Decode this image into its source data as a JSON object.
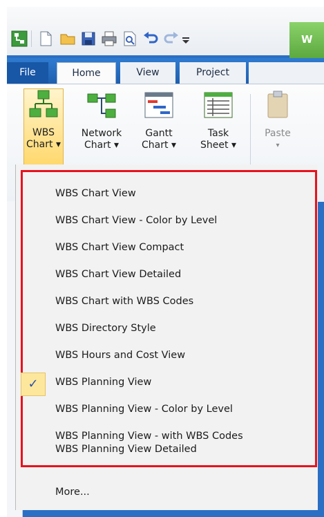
{
  "window": {
    "title_fragment": "W"
  },
  "tabs": [
    {
      "label": "File"
    },
    {
      "label": "Home"
    },
    {
      "label": "View"
    },
    {
      "label": "Project"
    }
  ],
  "ribbon": {
    "buttons": [
      {
        "line1": "WBS",
        "line2": "Chart ▾",
        "icon": "wbs-chart-icon"
      },
      {
        "line1": "Network",
        "line2": "Chart ▾",
        "icon": "network-chart-icon"
      },
      {
        "line1": "Gantt",
        "line2": "Chart ▾",
        "icon": "gantt-chart-icon"
      },
      {
        "line1": "Task",
        "line2": "Sheet ▾",
        "icon": "task-sheet-icon"
      },
      {
        "line1": "Paste",
        "line2": "▾",
        "icon": "paste-icon"
      }
    ]
  },
  "menu": {
    "items": [
      {
        "label": "WBS Chart View"
      },
      {
        "label": "WBS Chart View - Color by Level"
      },
      {
        "label": "WBS Chart View Compact"
      },
      {
        "label": "WBS Chart View Detailed"
      },
      {
        "label": "WBS Chart with WBS Codes"
      },
      {
        "label": "WBS Directory Style"
      },
      {
        "label": "WBS Hours and Cost View"
      },
      {
        "label": "WBS Planning View"
      },
      {
        "label": "WBS Planning View - Color by Level"
      },
      {
        "label": "WBS Planning View - with WBS Codes"
      },
      {
        "label": "WBS Planning View Detailed"
      }
    ],
    "checked_index": 7,
    "check_symbol": "✓",
    "more_label": "More..."
  },
  "colors": {
    "highlight_border": "#e8121d",
    "app_accent": "#2a6fc4",
    "active_button": "#ffd86b"
  }
}
